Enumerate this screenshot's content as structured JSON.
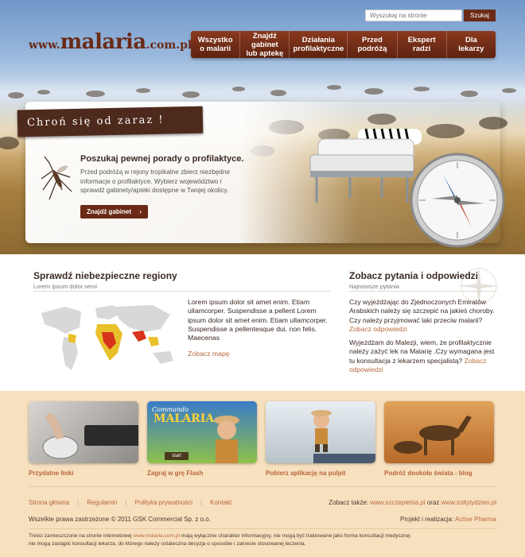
{
  "header": {
    "search_placeholder": "Wyszukaj na stronie",
    "search_button": "Szukaj",
    "logo": {
      "www": "www.",
      "name": "malaria",
      "tld": ".com.pl"
    },
    "nav": [
      {
        "line1": "Wszystko",
        "line2": "o malarii"
      },
      {
        "line1": "Znajdź gabinet",
        "line2": "lub aptekę"
      },
      {
        "line1": "Działania",
        "line2": "profilaktyczne"
      },
      {
        "line1": "Przed",
        "line2": "podróżą"
      },
      {
        "line1": "Ekspert",
        "line2": "radzi"
      },
      {
        "line1": "Dla",
        "line2": "lekarzy"
      }
    ]
  },
  "hero": {
    "banner": "Chroń się od zaraz !",
    "title": "Poszukaj pewnej porady o profilaktyce.",
    "text": "Przed podróżą w rejony tropikalne zbierz niezbędne informacje o profilaktyce. Wybierz województwo i sprawdź gabinety/apteki dostępne w Twojej okolicy.",
    "button": "Znajdź gabinet",
    "button_arrow": "›"
  },
  "regions": {
    "title": "Sprawdź niebezpieczne regiony",
    "subtitle": "Lorem ipsum dolor semi",
    "text": "Lorem ipsum dolor sit amet enim. Etiam ullamcorper. Suspendisse a pellent Lorem ipsum dolor sit amet enim. Etiam ullamcorper. Suspendisse a pellentesque dui, non felis. Maecenas",
    "map_link": "Zobacz mapę"
  },
  "qa": {
    "title": "Zobacz pytania i odpowiedzi",
    "subtitle": "Najnowsze pytania",
    "items": [
      {
        "q": "Czy wyjeżdżając do Zjednoczonych Emiratów Arabskich należy się szczepić na jakieś choroby. Czy należy przyjmować laki przeciw malarii?",
        "link": "Zobacz odpowiedzi"
      },
      {
        "q": "Wyjeżdżam do Malezji, wiem, że profilaktycznie należy zażyć lek na Malarię .Czy wymagana jest tu konsultacja z lekarzem specjalistą?",
        "link": "Zobacz odpowiedzi"
      }
    ]
  },
  "thumbs": [
    {
      "label": "Przydatne linki"
    },
    {
      "label": "Zagraj w grę Flash",
      "game_title_1": "Commando",
      "game_title_2": "MALARIA",
      "game_start": "start"
    },
    {
      "label": "Pobierz aplikację na pulpit"
    },
    {
      "label": "Podróż dookoła świata - blog"
    }
  ],
  "footer": {
    "links": [
      "Strona główna",
      "Regulamin",
      "Polityka prywatności",
      "Kontakt"
    ],
    "see_also_prefix": "Zobacz także:",
    "see_also_1": "www.szczepienia.pl",
    "see_also_mid": "oraz",
    "see_also_2": "www.zoltytydzien.pl",
    "copyright": "Wszelkie prawa zastrzeżone © 2011 GSK Commercial Sp. z o.o.",
    "realization_prefix": "Projekt i realizacja:",
    "realization_link": "Active Pharma",
    "disclaimer_1": "Treści zamieszczone na stronie internetowej",
    "disclaimer_link": "www.malaria.com.pl",
    "disclaimer_2": "mają wyłącznie charakter informacyjny, nie mogą być traktowane jako forma konsultacji medycznej",
    "disclaimer_3": "nie mogą zastąpić konsultacji lekarza, do którego należy ostateczna decyzja o sposobie i zakresie stosowanej leczenia."
  },
  "colors": {
    "brand": "#6a2a16",
    "link": "#b8653a",
    "footer_bg": "#f7e0be"
  }
}
